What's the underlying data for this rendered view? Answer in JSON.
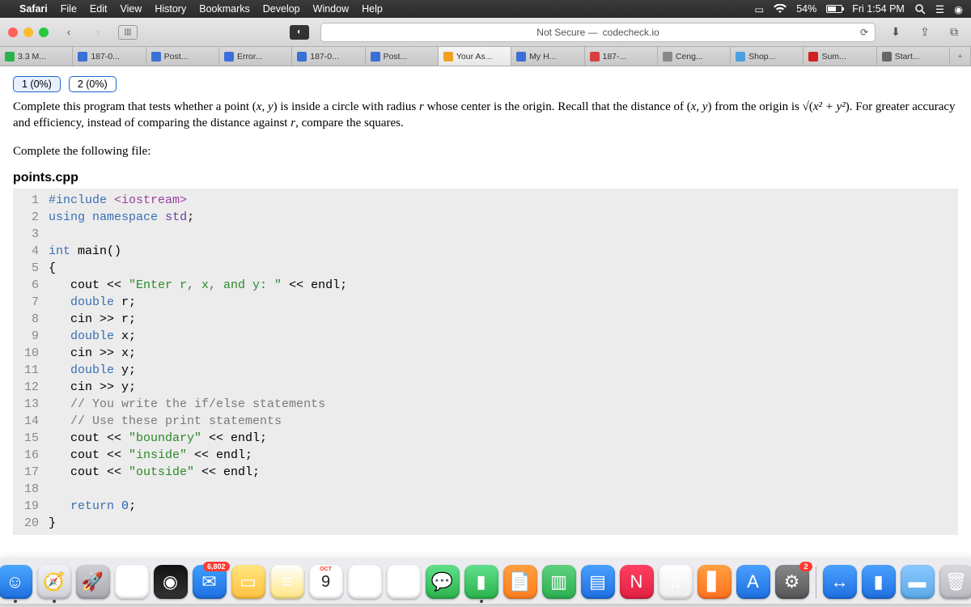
{
  "menubar": {
    "app": "Safari",
    "items": [
      "File",
      "Edit",
      "View",
      "History",
      "Bookmarks",
      "Develop",
      "Window",
      "Help"
    ],
    "battery_pct": "54%",
    "clock": "Fri 1:54 PM"
  },
  "toolbar": {
    "url_prefix": "Not Secure —",
    "url_host": "codecheck.io"
  },
  "tabs": [
    {
      "label": "3.3 M...",
      "favcolor": "#2bb24c"
    },
    {
      "label": "187-0...",
      "favcolor": "#3a6fd8"
    },
    {
      "label": "Post...",
      "favcolor": "#3a6fd8"
    },
    {
      "label": "Error...",
      "favcolor": "#3a6fd8"
    },
    {
      "label": "187-0...",
      "favcolor": "#3a6fd8"
    },
    {
      "label": "Post...",
      "favcolor": "#3a6fd8"
    },
    {
      "label": "Your As...",
      "favcolor": "#f0a020",
      "active": true
    },
    {
      "label": "My H...",
      "favcolor": "#3a6fd8"
    },
    {
      "label": "187-...",
      "favcolor": "#d84040"
    },
    {
      "label": "Ceng...",
      "favcolor": "#888"
    },
    {
      "label": "Shop...",
      "favcolor": "#4aa0e0"
    },
    {
      "label": "Sum...",
      "favcolor": "#d02020"
    },
    {
      "label": "Start...",
      "favcolor": "#666"
    }
  ],
  "test_tabs": [
    {
      "label": "1 (0%)",
      "selected": true
    },
    {
      "label": "2 (0%)",
      "selected": false
    }
  ],
  "problem": {
    "p1a": "Complete this program that tests whether a point (",
    "p1b": ") is inside a circle with radius ",
    "p1c": " whose center is the origin. Recall that the distance of (",
    "p1d": ") from the origin is √(",
    "p1e": "). For greater accuracy and efficiency, instead of comparing the distance against ",
    "p1f": ", compare the squares.",
    "vars": {
      "xy": "x, y",
      "r": "r",
      "xy2": "x, y",
      "sq": "x² + y²",
      "r2": "r"
    },
    "p2": "Complete the following file:"
  },
  "filename": "points.cpp",
  "code": {
    "lines": [
      {
        "n": 1,
        "html": "<span class='tok-kw'>#include</span> <span class='tok-inc'>&lt;iostream&gt;</span>"
      },
      {
        "n": 2,
        "html": "<span class='tok-kw'>using</span> <span class='tok-kw'>namespace</span> <span class='tok-ns'>std</span>;"
      },
      {
        "n": 3,
        "html": ""
      },
      {
        "n": 4,
        "html": "<span class='tok-type'>int</span> main()"
      },
      {
        "n": 5,
        "html": "{"
      },
      {
        "n": 6,
        "html": "   cout &lt;&lt; <span class='tok-str'>\"Enter r, x, and y: \"</span> &lt;&lt; endl;"
      },
      {
        "n": 7,
        "html": "   <span class='tok-type'>double</span> r;"
      },
      {
        "n": 8,
        "html": "   cin &gt;&gt; r;"
      },
      {
        "n": 9,
        "html": "   <span class='tok-type'>double</span> x;"
      },
      {
        "n": 10,
        "html": "   cin &gt;&gt; x;"
      },
      {
        "n": 11,
        "html": "   <span class='tok-type'>double</span> y;"
      },
      {
        "n": 12,
        "html": "   cin &gt;&gt; y;"
      },
      {
        "n": 13,
        "html": "   <span class='tok-cmt'>// You write the if/else statements</span>"
      },
      {
        "n": 14,
        "html": "   <span class='tok-cmt'>// Use these print statements</span>"
      },
      {
        "n": 15,
        "html": "   cout &lt;&lt; <span class='tok-str'>\"boundary\"</span> &lt;&lt; endl;"
      },
      {
        "n": 16,
        "html": "   cout &lt;&lt; <span class='tok-str'>\"inside\"</span> &lt;&lt; endl;"
      },
      {
        "n": 17,
        "html": "   cout &lt;&lt; <span class='tok-str'>\"outside\"</span> &lt;&lt; endl;"
      },
      {
        "n": 18,
        "html": ""
      },
      {
        "n": 19,
        "html": "   <span class='tok-kw'>return</span> <span class='tok-num'>0</span>;"
      },
      {
        "n": 20,
        "html": "}"
      }
    ]
  },
  "dock": {
    "items": [
      {
        "name": "finder",
        "bg": "linear-gradient(#4aa8ff,#1e6fe0)",
        "glyph": "☺",
        "running": true
      },
      {
        "name": "safari",
        "bg": "linear-gradient(#f2f2f7,#d0d0d8)",
        "glyph": "🧭",
        "running": true
      },
      {
        "name": "launchpad",
        "bg": "linear-gradient(#cfcfd4,#a8a8b0)",
        "glyph": "🚀"
      },
      {
        "name": "chrome",
        "bg": "#fff",
        "glyph": "◐"
      },
      {
        "name": "siri",
        "bg": "linear-gradient(#111,#333)",
        "glyph": "◉"
      },
      {
        "name": "mail",
        "bg": "linear-gradient(#3ca0ff,#1e6fe0)",
        "glyph": "✉",
        "badge": "6,802"
      },
      {
        "name": "freeform",
        "bg": "linear-gradient(#ffe680,#ffc040)",
        "glyph": "▭"
      },
      {
        "name": "notes",
        "bg": "linear-gradient(#fff,#ffe680)",
        "glyph": "≡"
      },
      {
        "name": "calendar",
        "bg": "#fff",
        "month": "OCT",
        "day": "9"
      },
      {
        "name": "reminders",
        "bg": "#fff",
        "glyph": "⋮⋮"
      },
      {
        "name": "photos",
        "bg": "#fff",
        "glyph": "✿"
      },
      {
        "name": "messages",
        "bg": "linear-gradient(#5fe08a,#2bb24c)",
        "glyph": "💬"
      },
      {
        "name": "facetime",
        "bg": "linear-gradient(#5fe08a,#2bb24c)",
        "glyph": "▮",
        "running": true
      },
      {
        "name": "pages",
        "bg": "linear-gradient(#ff9f40,#ff7f20)",
        "glyph": "📄"
      },
      {
        "name": "numbers",
        "bg": "linear-gradient(#5fd080,#2bb050)",
        "glyph": "▥"
      },
      {
        "name": "keynote",
        "bg": "linear-gradient(#4aa0ff,#1e6fe0)",
        "glyph": "▤"
      },
      {
        "name": "news",
        "bg": "linear-gradient(#ff4060,#e02040)",
        "glyph": "N"
      },
      {
        "name": "music",
        "bg": "linear-gradient(#fff,#eee)",
        "glyph": "♫"
      },
      {
        "name": "books",
        "bg": "linear-gradient(#ff9f40,#ff7020)",
        "glyph": "▋"
      },
      {
        "name": "appstore",
        "bg": "linear-gradient(#4aa0ff,#1e6fe0)",
        "glyph": "A"
      },
      {
        "name": "settings",
        "bg": "linear-gradient(#888,#555)",
        "glyph": "⚙",
        "badge": "2"
      },
      {
        "name": "sep"
      },
      {
        "name": "teamviewer",
        "bg": "linear-gradient(#4aa0ff,#1e6fe0)",
        "glyph": "↔"
      },
      {
        "name": "camera",
        "bg": "linear-gradient(#4aa0ff,#1e6fe0)",
        "glyph": "▮"
      },
      {
        "name": "folder",
        "bg": "linear-gradient(#8ac8ff,#5aa8e8)",
        "glyph": "▬"
      },
      {
        "name": "trash",
        "bg": "linear-gradient(#d8d8dc,#b8b8c0)",
        "glyph": "🗑"
      }
    ]
  }
}
